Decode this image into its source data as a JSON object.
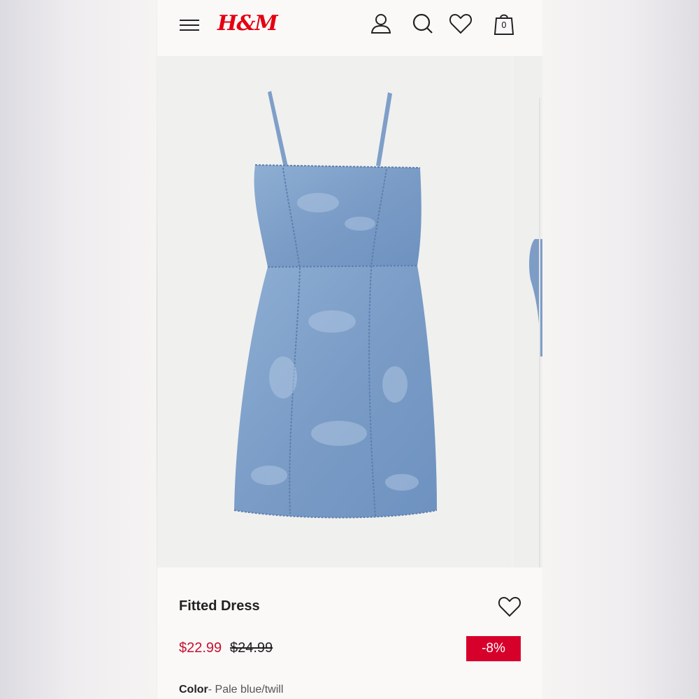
{
  "header": {
    "logo": "H&M",
    "bag_count": "0",
    "icons": [
      "menu-icon",
      "account-icon",
      "search-icon",
      "heart-icon",
      "shopping-bag-icon"
    ]
  },
  "product": {
    "title": "Fitted Dress",
    "price_current": "$22.99",
    "price_original": "$24.99",
    "discount": "-8%",
    "color_label": "Color",
    "color_value": "- Pale blue/twill"
  },
  "colors": {
    "brand_red": "#e50010",
    "sale_price": "#c8102e",
    "discount_badge": "#d6002a",
    "denim": "#7fa0c6"
  }
}
